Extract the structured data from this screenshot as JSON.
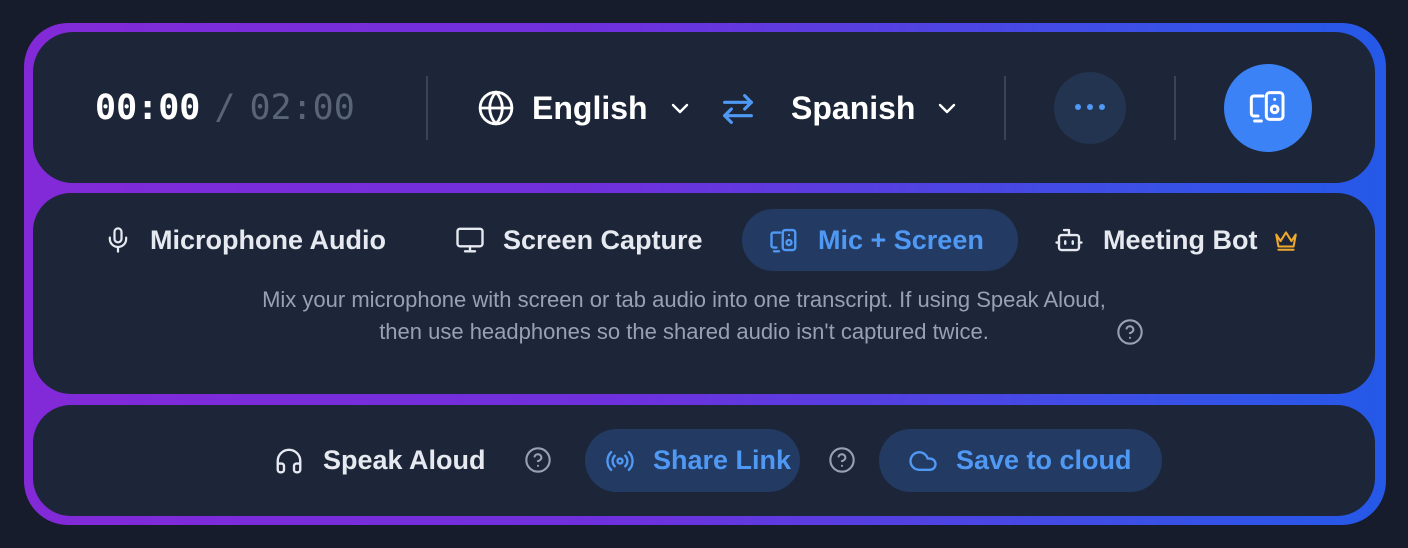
{
  "timer": {
    "current": "00:00",
    "separator": "/",
    "total": "02:00"
  },
  "languages": {
    "source": {
      "label": "English",
      "icon": "globe-icon"
    },
    "swap_icon": "swap-arrows-icon",
    "target": {
      "label": "Spanish"
    },
    "dropdown_icon": "chevron-down-icon"
  },
  "toolbar": {
    "more_icon": "more-horizontal-icon",
    "mode_button_icon": "mic-screen-icon"
  },
  "modes": [
    {
      "label": "Microphone Audio",
      "icon": "microphone-icon",
      "active": false
    },
    {
      "label": "Screen Capture",
      "icon": "monitor-icon",
      "active": false
    },
    {
      "label": "Mic + Screen",
      "icon": "mic-screen-icon",
      "active": true
    },
    {
      "label": "Meeting Bot",
      "icon": "robot-icon",
      "badge_icon": "crown-icon",
      "active": false
    }
  ],
  "description": "Mix your microphone with screen or tab audio into one transcript. If using Speak Aloud, then use headphones so the shared audio isn't captured twice.",
  "actions": {
    "speak_aloud": {
      "label": "Speak Aloud",
      "icon": "headphones-icon"
    },
    "share_link": {
      "label": "Share Link",
      "icon": "broadcast-icon"
    },
    "save_cloud": {
      "label": "Save to cloud",
      "icon": "cloud-icon"
    }
  },
  "colors": {
    "background": "#161c2b",
    "panel": "#1d2638",
    "accent": "#3b82f6",
    "accent_text": "#4f99f5",
    "active_pill": "#233a63",
    "border_gradient_start": "#8329d8",
    "border_gradient_end": "#2559e8",
    "crown": "#f0a92c"
  }
}
